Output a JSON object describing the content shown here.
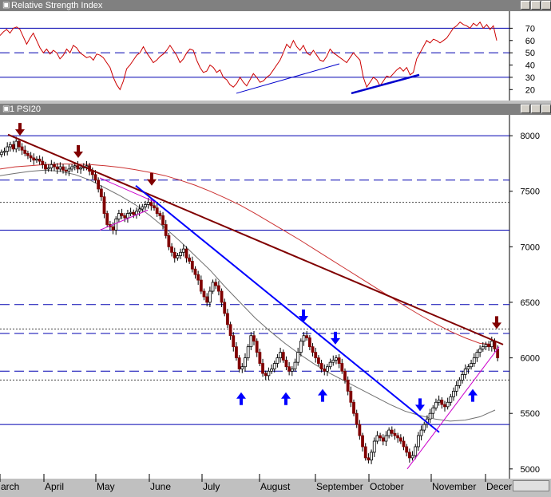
{
  "rsi_pane": {
    "title": "Relative Strength Index"
  },
  "price_pane": {
    "title": "PSI20",
    "title_prefix": "1"
  },
  "chart_data": [
    {
      "type": "line",
      "title": "Relative Strength Index",
      "ylim": [
        15,
        80
      ],
      "yticks": [
        70,
        60,
        50,
        40,
        30,
        20
      ],
      "reference_lines": [
        {
          "value": 70,
          "style": "solid"
        },
        {
          "value": 50,
          "style": "dashed"
        },
        {
          "value": 30,
          "style": "solid"
        }
      ],
      "series": [
        {
          "color": "#cc0000",
          "values": [
            64,
            67,
            69,
            66,
            70,
            71,
            69,
            63,
            57,
            62,
            66,
            60,
            54,
            50,
            53,
            49,
            52,
            50,
            45,
            48,
            53,
            50,
            56,
            54,
            50,
            48,
            46,
            47,
            44,
            49,
            48,
            46,
            42,
            38,
            30,
            24,
            20,
            27,
            37,
            40,
            44,
            48,
            50,
            55,
            50,
            46,
            42,
            44,
            47,
            49,
            52,
            56,
            52,
            48,
            42,
            45,
            50,
            53,
            52,
            44,
            38,
            34,
            35,
            40,
            38,
            34,
            36,
            30,
            28,
            24,
            22,
            25,
            30,
            26,
            23,
            28,
            33,
            30,
            26,
            27,
            30,
            32,
            36,
            40,
            44,
            50,
            57,
            54,
            60,
            55,
            52,
            56,
            50,
            48,
            52,
            48,
            44,
            43,
            47,
            53,
            50,
            48,
            46,
            44,
            42,
            46,
            50,
            47,
            44,
            30,
            22,
            26,
            30,
            28,
            23,
            27,
            31,
            30,
            33,
            36,
            38,
            35,
            38,
            32,
            34,
            45,
            50,
            55,
            60,
            58,
            61,
            60,
            58,
            60,
            62,
            66,
            70,
            72,
            75,
            73,
            72,
            70,
            74,
            72,
            75,
            70,
            73,
            69,
            72,
            60
          ]
        }
      ],
      "trendlines": [
        {
          "name": "support-1",
          "from": [
            296,
            17
          ],
          "to": [
            425,
            41
          ],
          "color": "#0000cc"
        },
        {
          "name": "support-2",
          "from": [
            440,
            17
          ],
          "to": [
            525,
            32
          ],
          "color": "#0000cc"
        }
      ],
      "grid": false
    },
    {
      "type": "candlestick",
      "title": "PSI20",
      "ylim": [
        4970,
        8130
      ],
      "yticks": [
        8000,
        7500,
        7000,
        6500,
        6000,
        5500,
        5000
      ],
      "x_tick_labels": [
        "March",
        "April",
        "May",
        "June",
        "July",
        "August",
        "September",
        "October",
        "November",
        "December"
      ],
      "x_tick_labels_shown": [
        "arch",
        "April",
        "May",
        "June",
        "July",
        "August",
        "September",
        "October",
        "November",
        "Decer"
      ],
      "x_tick_positions": [
        0,
        55,
        120,
        187,
        253,
        325,
        395,
        462,
        540,
        608
      ],
      "x_start": 0,
      "x_end": 625,
      "close": [
        7850,
        7860,
        7900,
        7920,
        7880,
        7950,
        7900,
        7870,
        7840,
        7820,
        7800,
        7780,
        7790,
        7770,
        7740,
        7700,
        7710,
        7740,
        7720,
        7700,
        7720,
        7690,
        7680,
        7700,
        7720,
        7730,
        7700,
        7710,
        7720,
        7730,
        7680,
        7650,
        7600,
        7520,
        7450,
        7300,
        7200,
        7180,
        7150,
        7250,
        7300,
        7280,
        7260,
        7300,
        7310,
        7290,
        7320,
        7340,
        7360,
        7380,
        7400,
        7370,
        7350,
        7300,
        7280,
        7200,
        7100,
        7000,
        6950,
        6900,
        6920,
        6950,
        6980,
        6900,
        6870,
        6800,
        6750,
        6700,
        6600,
        6550,
        6500,
        6600,
        6680,
        6650,
        6600,
        6500,
        6400,
        6300,
        6200,
        6100,
        6000,
        5900,
        5920,
        6000,
        6100,
        6200,
        6150,
        6050,
        5950,
        5860,
        5840,
        5880,
        5900,
        5950,
        6000,
        6050,
        5980,
        5920,
        5880,
        5900,
        5960,
        6050,
        6150,
        6200,
        6180,
        6100,
        6050,
        6000,
        5950,
        5900,
        5880,
        5920,
        5960,
        5980,
        6000,
        5950,
        5880,
        5800,
        5700,
        5600,
        5500,
        5400,
        5300,
        5200,
        5100,
        5080,
        5150,
        5250,
        5300,
        5280,
        5250,
        5300,
        5350,
        5320,
        5300,
        5280,
        5250,
        5200,
        5150,
        5100,
        5120,
        5200,
        5300,
        5350,
        5400,
        5450,
        5500,
        5550,
        5600,
        5620,
        5580,
        5560,
        5600,
        5650,
        5700,
        5750,
        5800,
        5850,
        5900,
        5920,
        5950,
        6000,
        6050,
        6080,
        6100,
        6120,
        6100,
        6150,
        6080,
        6000
      ],
      "ma_long": [
        7700,
        7720,
        7730,
        7740,
        7745,
        7745,
        7740,
        7730,
        7715,
        7695,
        7670,
        7640,
        7600,
        7555,
        7500,
        7440,
        7375,
        7300,
        7220,
        7140,
        7060,
        6975,
        6890,
        6805,
        6720,
        6635,
        6550,
        6465,
        6385,
        6310,
        6240,
        6180,
        6130,
        6120
      ],
      "ma_short": [
        7640,
        7660,
        7680,
        7690,
        7680,
        7650,
        7600,
        7530,
        7460,
        7380,
        7280,
        7170,
        7050,
        6920,
        6790,
        6640,
        6500,
        6360,
        6240,
        6130,
        6030,
        5940,
        5860,
        5790,
        5720,
        5650,
        5580,
        5520,
        5480,
        5450,
        5430,
        5440,
        5470,
        5530
      ],
      "reference_lines": [
        {
          "value": 8000,
          "style": "solid"
        },
        {
          "value": 7600,
          "style": "dashed"
        },
        {
          "value": 7400,
          "style": "dotted"
        },
        {
          "value": 7150,
          "style": "solid"
        },
        {
          "value": 6480,
          "style": "dashed"
        },
        {
          "value": 6260,
          "style": "dotted"
        },
        {
          "value": 6220,
          "style": "dashed"
        },
        {
          "value": 5880,
          "style": "dashed"
        },
        {
          "value": 5800,
          "style": "dotted"
        },
        {
          "value": 5400,
          "style": "solid"
        }
      ],
      "trendlines": [
        {
          "name": "long-term-resistance",
          "from": [
            10,
            8010
          ],
          "to": [
            630,
            6120
          ],
          "color": "#800000"
        },
        {
          "name": "down-trend",
          "from": [
            170,
            7550
          ],
          "to": [
            550,
            5330
          ],
          "color": "#0000ff"
        },
        {
          "name": "left-wedge-top",
          "from": [
            125,
            7620
          ],
          "to": [
            195,
            7400
          ],
          "color": "#cc00cc"
        },
        {
          "name": "left-wedge-bottom",
          "from": [
            125,
            7150
          ],
          "to": [
            185,
            7330
          ],
          "color": "#cc00cc"
        },
        {
          "name": "up-trend",
          "from": [
            510,
            5000
          ],
          "to": [
            625,
            6100
          ],
          "color": "#cc00cc"
        }
      ],
      "arrows_down_red": [
        [
          25,
          8000
        ],
        [
          98,
          7800
        ],
        [
          190,
          7550
        ],
        [
          622,
          6260
        ]
      ],
      "arrows_down_blue": [
        [
          380,
          6320
        ],
        [
          420,
          6120
        ],
        [
          526,
          5520
        ]
      ],
      "arrows_up_blue": [
        [
          302,
          5690
        ],
        [
          358,
          5690
        ],
        [
          404,
          5720
        ],
        [
          592,
          5720
        ]
      ],
      "grid": false
    }
  ]
}
